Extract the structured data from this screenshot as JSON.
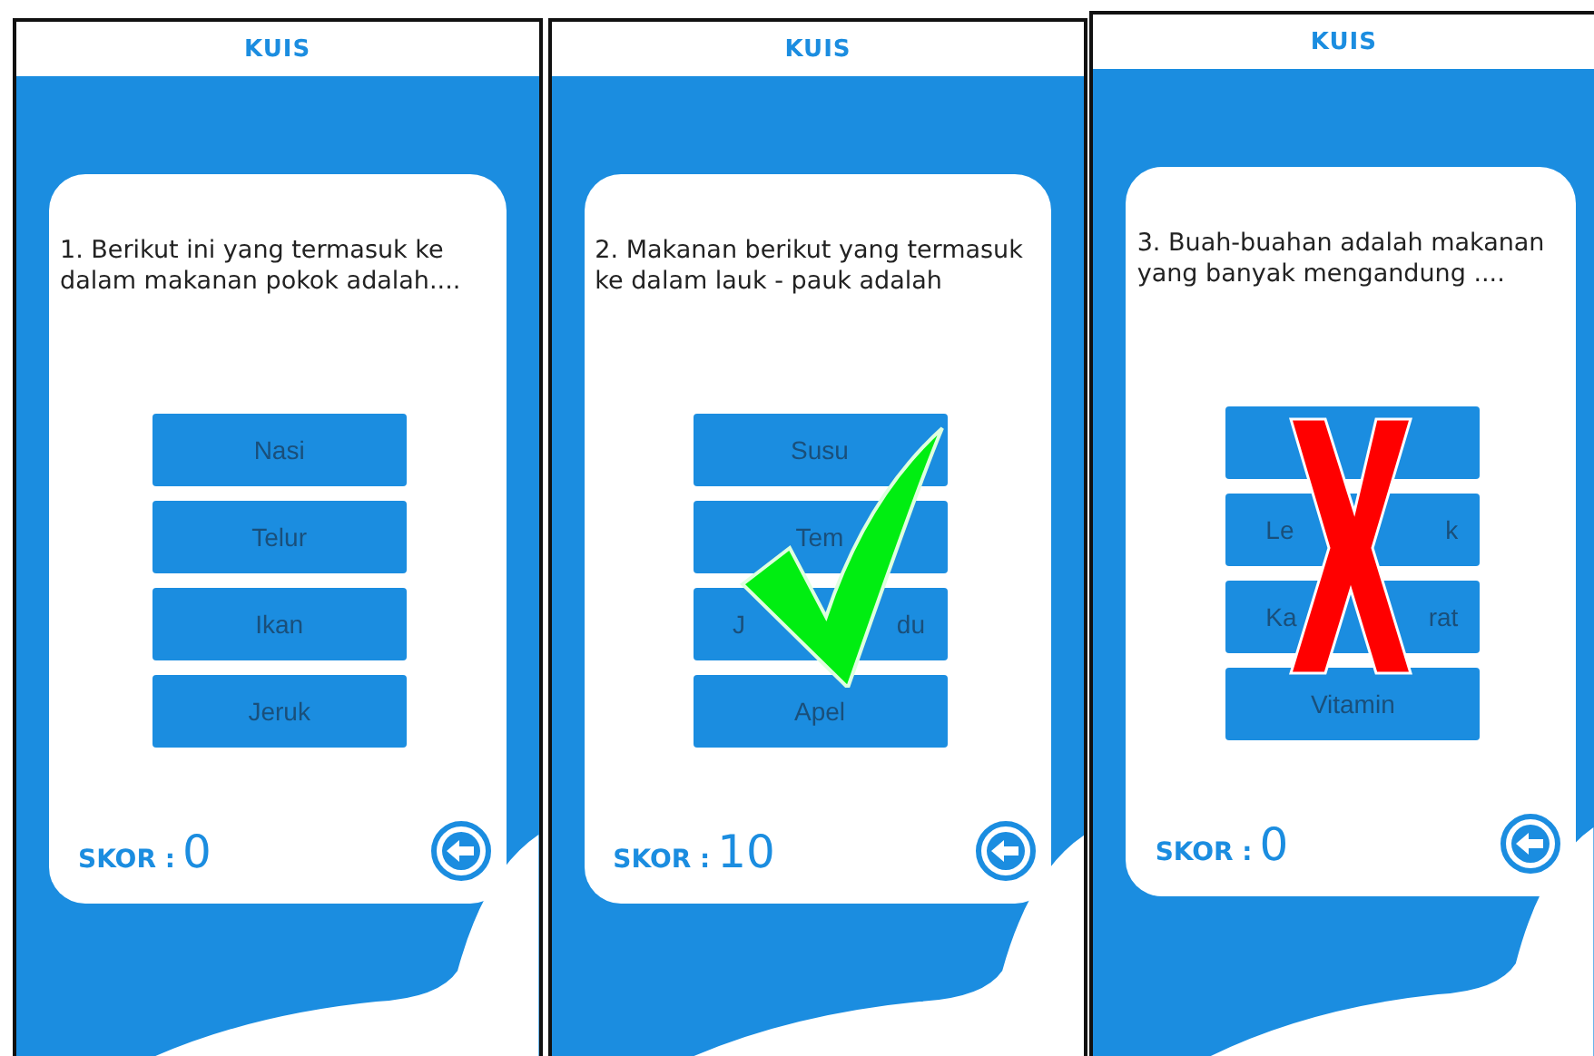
{
  "screens": [
    {
      "title": "KUIS",
      "question": "1. Berikut ini yang termasuk ke dalam makanan pokok adalah....",
      "options": [
        {
          "kind": "answer",
          "parts": [
            "Nasi"
          ]
        },
        {
          "kind": "answer",
          "parts": [
            "Telur"
          ]
        },
        {
          "kind": "answer",
          "parts": [
            "Ikan"
          ]
        },
        {
          "kind": "answer",
          "parts": [
            "Jeruk"
          ]
        }
      ],
      "score_label": "SKOR :",
      "score": "0"
    },
    {
      "title": "KUIS",
      "question": "2. Makanan berikut yang termasuk ke dalam lauk - pauk adalah",
      "options": [
        {
          "kind": "answer",
          "parts": [
            "Susu"
          ]
        },
        {
          "kind": "answer",
          "parts": [
            "Tem"
          ]
        },
        {
          "kind": "answer",
          "parts": [
            "J",
            "du"
          ]
        },
        {
          "kind": "answer",
          "parts": [
            "Apel"
          ]
        }
      ],
      "score_label": "SKOR :",
      "score": "10",
      "mark": {
        "kind": "check"
      }
    },
    {
      "title": "KUIS",
      "question": "3. Buah-buahan adalah makanan yang banyak mengandung ....",
      "options": [
        {
          "kind": "covered"
        },
        {
          "kind": "answer",
          "parts": [
            "Le",
            "k"
          ]
        },
        {
          "kind": "answer",
          "parts": [
            "Ka",
            "rat"
          ]
        },
        {
          "kind": "answer",
          "parts": [
            "Vitamin"
          ]
        }
      ],
      "score_label": "SKOR :",
      "score": "0",
      "mark": {
        "kind": "cross"
      }
    }
  ]
}
